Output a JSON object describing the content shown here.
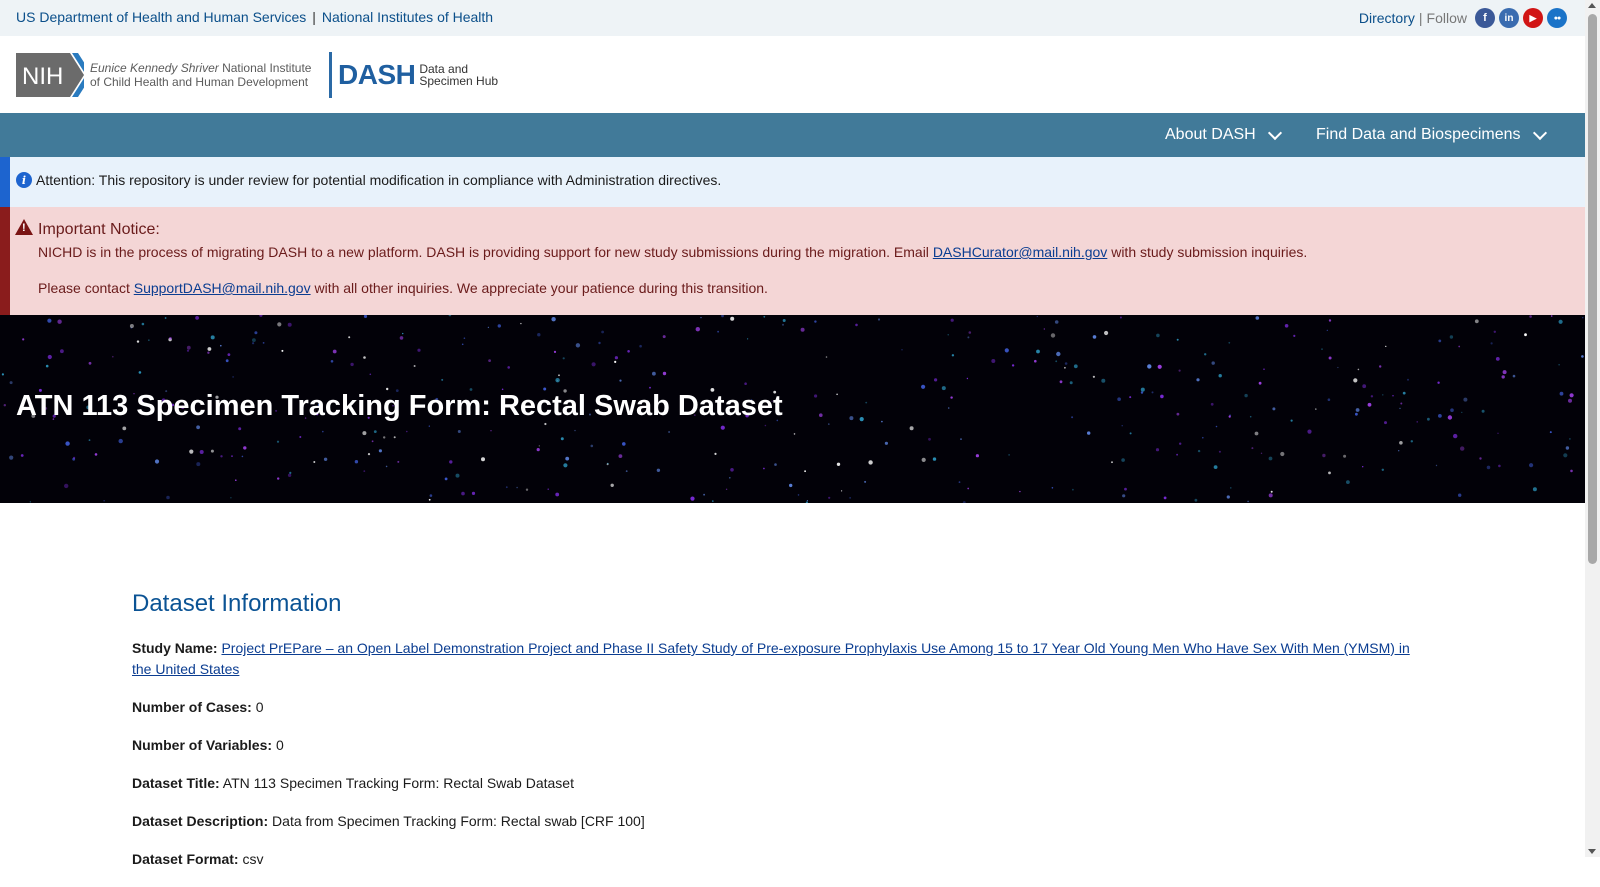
{
  "utility_bar": {
    "hhs_link": "US Department of Health and Human Services",
    "separator": "|",
    "nih_link": "National Institutes of Health",
    "directory_link": "Directory",
    "pipe": "|",
    "follow_label": "Follow",
    "social": [
      {
        "name": "facebook-icon",
        "glyph": "f"
      },
      {
        "name": "linkedin-icon",
        "glyph": "in"
      },
      {
        "name": "youtube-icon",
        "glyph": "▶"
      },
      {
        "name": "flickr-icon",
        "glyph": "●●"
      }
    ]
  },
  "header": {
    "nih_mark": "NIH",
    "institute_line1_italic": "Eunice Kennedy Shriver",
    "institute_line1_rest": " National Institute",
    "institute_line2": "of Child Health and Human Development",
    "dash_word": "DASH",
    "dash_sub1": "Data and",
    "dash_sub2": "Specimen Hub"
  },
  "nav": {
    "about": "About DASH",
    "find": "Find Data and Biospecimens"
  },
  "attention": {
    "icon": "i",
    "message": "Attention: This repository is under review for potential modification in compliance with Administration directives."
  },
  "notice": {
    "title": "Important Notice:",
    "line1_before": "NICHD is in the process of migrating DASH to a new platform. DASH is providing support for new study submissions during the migration. Email ",
    "line1_email": "DASHCurator@mail.nih.gov",
    "line1_after": " with study submission inquiries.",
    "line2_before": "Please contact ",
    "line2_email": "SupportDASH@mail.nih.gov",
    "line2_after": " with all other inquiries. We appreciate your patience during this transition."
  },
  "hero": {
    "title": "ATN 113 Specimen Tracking Form: Rectal Swab Dataset"
  },
  "dataset": {
    "heading": "Dataset Information",
    "study_name_label": "Study Name:",
    "study_name_value": "Project PrEPare – an Open Label Demonstration Project and Phase II Safety Study of Pre-exposure Prophylaxis Use Among 15 to 17 Year Old Young Men Who Have Sex With Men (YMSM) in the United States",
    "cases_label": "Number of Cases:",
    "cases_value": "0",
    "variables_label": "Number of Variables:",
    "variables_value": "0",
    "title_label": "Dataset Title:",
    "title_value": "ATN 113 Specimen Tracking Form: Rectal Swab Dataset",
    "description_label": "Dataset Description:",
    "description_value": "Data from Specimen Tracking Form: Rectal swab [CRF 100]",
    "format_label": "Dataset Format:",
    "format_value": "csv"
  },
  "colors": {
    "nav_bg": "#417a99",
    "attention_bar": "#1d64cf",
    "notice_bar": "#8a1c1c",
    "link": "#0b3d91",
    "heading": "#0b5394"
  }
}
